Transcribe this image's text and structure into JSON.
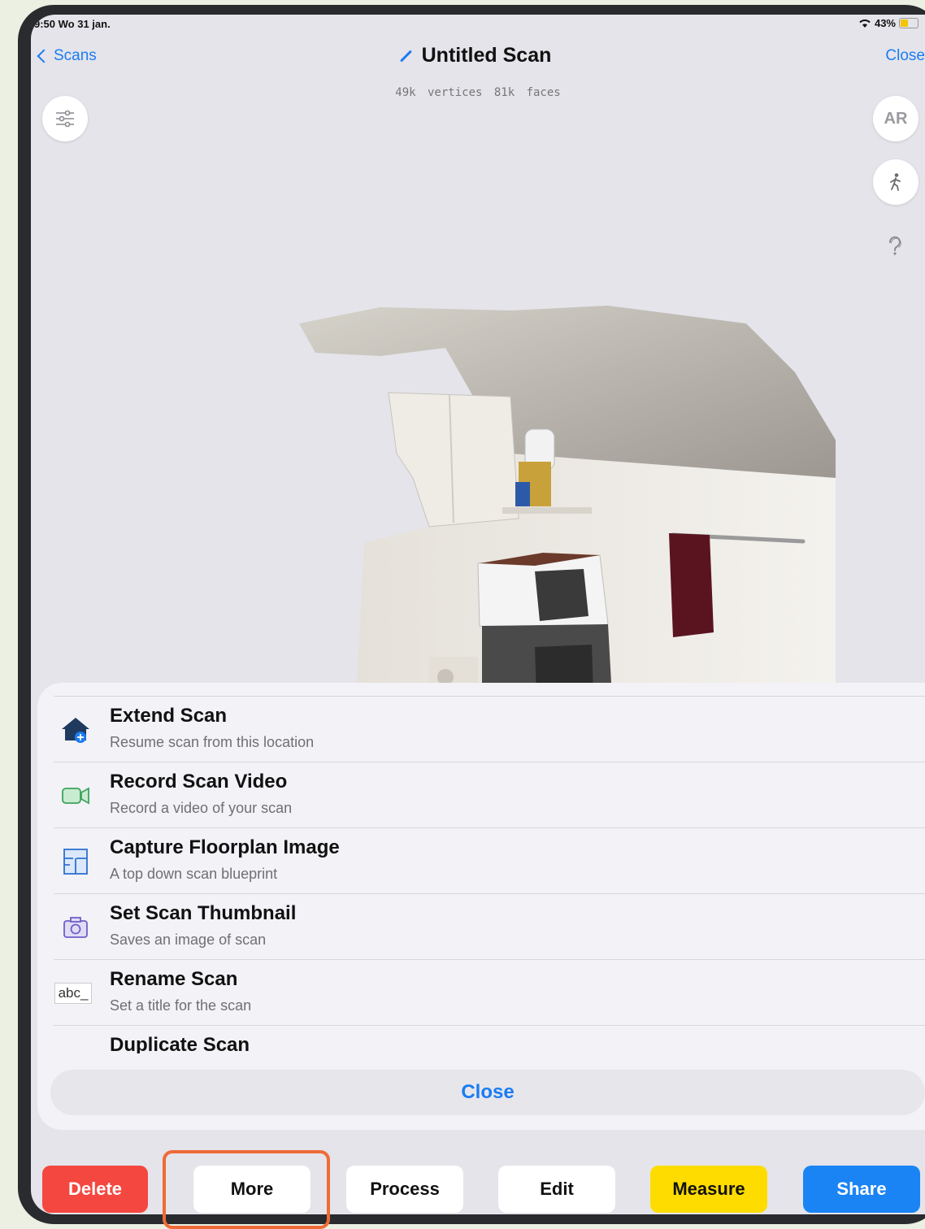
{
  "status": {
    "time": "9:50  Wo 31 jan.",
    "battery": "43%"
  },
  "nav": {
    "back_label": "Scans",
    "title": "Untitled Scan",
    "close_label": "Close"
  },
  "scan_stats": "49k vertices  81k faces",
  "side_buttons": {
    "ar_label": "AR"
  },
  "menu": {
    "items": [
      {
        "title": "Extend Scan",
        "subtitle": "Resume scan from this location",
        "icon": "house-plus-icon"
      },
      {
        "title": "Record Scan Video",
        "subtitle": "Record a video of your scan",
        "icon": "video-camera-icon"
      },
      {
        "title": "Capture Floorplan Image",
        "subtitle": "A top down scan blueprint",
        "icon": "floorplan-icon"
      },
      {
        "title": "Set Scan Thumbnail",
        "subtitle": "Saves an image of scan",
        "icon": "camera-icon"
      },
      {
        "title": "Rename Scan",
        "subtitle": "Set a title for the scan",
        "icon": "text-field-icon",
        "icon_text": "abc_"
      },
      {
        "title": "Duplicate Scan",
        "subtitle": "",
        "icon": "duplicate-icon"
      }
    ],
    "close_label": "Close"
  },
  "toolbar": {
    "delete": "Delete",
    "more": "More",
    "process": "Process",
    "edit": "Edit",
    "measure": "Measure",
    "share": "Share"
  },
  "colors": {
    "accent": "#1b7cf2",
    "delete": "#f4473f",
    "measure": "#fedc00",
    "share": "#1b84f5",
    "highlight": "#ef6b37"
  }
}
